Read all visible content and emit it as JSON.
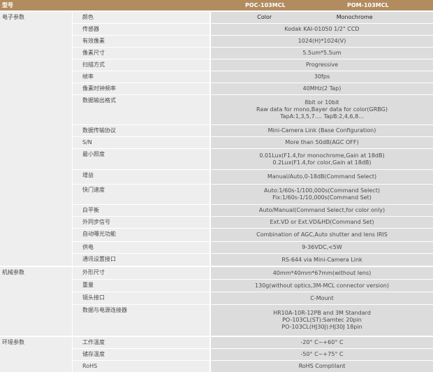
{
  "header": {
    "model": "型号",
    "poc": "POC-103MCL",
    "pom": "POM-103MCL"
  },
  "groups": {
    "electronic": "电子参数",
    "mechanical": "机械参数",
    "environment": "环境参数"
  },
  "rows": [
    {
      "label": "颜色",
      "color": "Color",
      "mono": "Monochrome"
    },
    {
      "label": "传感器",
      "value": "Kodak KAI-01050 1/2\" CCD"
    },
    {
      "label": "有效像素",
      "value": "1024(H)*1024(V)"
    },
    {
      "label": "像素尺寸",
      "value": "5.5um*5.5um"
    },
    {
      "label": "扫描方式",
      "value": "Progressive"
    },
    {
      "label": "帧率",
      "value": "30fps"
    },
    {
      "label": "像素时钟频率",
      "value": "40MHz(2 Tap)"
    },
    {
      "label": "数据输出格式",
      "value": "8bit or 10bit\nRaw data for mono,Bayer data for color(GRBG)\nTapA:1,3,5,7....  TapB:2,4,6,8..."
    },
    {
      "label": "数据传输协议",
      "value": "Mini-Camera Link (Base Configuration)"
    },
    {
      "label": "S/N",
      "value": "More than 50dB(AGC OFF)"
    },
    {
      "label": "最小照度",
      "value": "0.01Lux(F1.4,for monochrome,Gain at 18dB)\n0.2Lux(F1.4,for color,Gain at 18dB)"
    },
    {
      "label": "增益",
      "value": "Manual/Auto,0-18dB(Command Select)"
    },
    {
      "label": "快门速度",
      "value": "Auto:1/60s-1/100,000s(Command Select)\nFix:1/60s-1/10,000s(Command Set)"
    },
    {
      "label": "白平衡",
      "value": "Auto/Manual(Command Select,for color only)"
    },
    {
      "label": "外同步信号",
      "value": "Ext.VD or Ext.VD&HD(Command Set)"
    },
    {
      "label": "自动曝光功能",
      "value": "Combination of AGC,Auto shutter and lens IRIS"
    },
    {
      "label": "供电",
      "value": "9-36VDC,<5W"
    },
    {
      "label": "通讯设置接口",
      "value": "RS-644 via Mini-Camera Link"
    },
    {
      "label": "外形尺寸",
      "value": "40mm*40mm*67mm(without lens)"
    },
    {
      "label": "重量",
      "value": "130g(without optics,3M-MCL connector version)"
    },
    {
      "label": "镜头接口",
      "value": "C-Mount"
    },
    {
      "label": "数据与电源连接器",
      "value": "HR10A-10R-12PB and 3M Standard\nPO-103CL(ST):Samtec 20pin\nPO-103CL(HJ30J):HJ30J 18pin"
    },
    {
      "label": "工作温度",
      "value": "-20° C~+60° C"
    },
    {
      "label": "储存温度",
      "value": "-50° C~+75° C"
    },
    {
      "label": "RoHS",
      "value": "RoHS Complilant"
    }
  ]
}
